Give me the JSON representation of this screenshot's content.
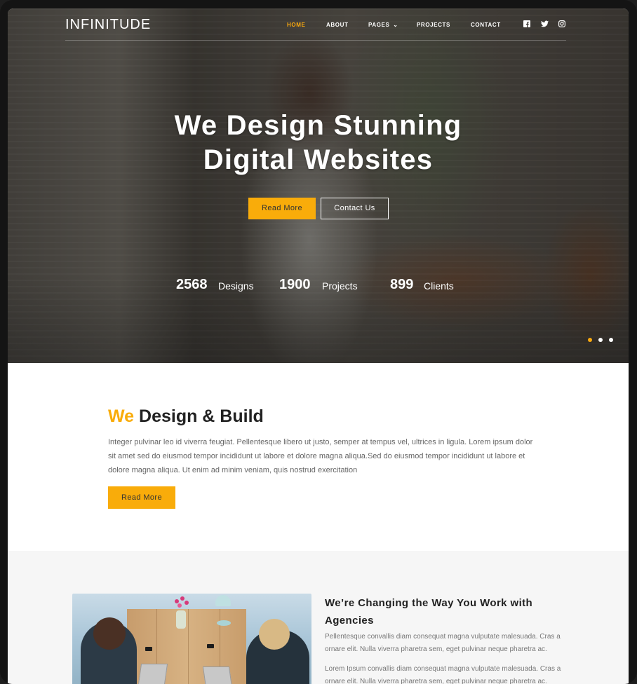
{
  "brand": {
    "name": "INFINITUDE",
    "accent_color": "#f9ac0a"
  },
  "nav": {
    "items": [
      {
        "label": "HOME",
        "active": true
      },
      {
        "label": "ABOUT",
        "active": false
      },
      {
        "label": "PAGES",
        "active": false,
        "has_dropdown": true
      },
      {
        "label": "PROJECTS",
        "active": false
      },
      {
        "label": "CONTACT",
        "active": false
      }
    ],
    "dropdown_caret": "⌄",
    "social_icons": [
      "facebook-icon",
      "twitter-icon",
      "instagram-icon"
    ]
  },
  "hero": {
    "title_line1": "We Design Stunning",
    "title_line2": "Digital Websites",
    "primary_button": "Read More",
    "secondary_button": "Contact Us",
    "stats": [
      {
        "value": "2568",
        "label": "Designs"
      },
      {
        "value": "1900",
        "label": "Projects"
      },
      {
        "value": "899",
        "label": "Clients"
      }
    ],
    "slider_dots": 3,
    "active_dot": 0
  },
  "about": {
    "title_accent": "We",
    "title_rest": "Design & Build",
    "paragraph": "Integer pulvinar leo id viverra feugiat. Pellentesque libero ut justo, semper at tempus vel, ultrices in ligula. Lorem ipsum dolor sit amet sed do eiusmod tempor incididunt ut labore et dolore magna aliqua.Sed do eiusmod tempor incididunt ut labore et dolore magna aliqua. Ut enim ad minim veniam, quis nostrud exercitation",
    "button": "Read More"
  },
  "agency": {
    "title": "We’re Changing the Way You Work with Agencies",
    "paragraph1": "Pellentesque convallis diam consequat magna vulputate malesuada. Cras a ornare elit. Nulla viverra pharetra sem, eget pulvinar neque pharetra ac.",
    "paragraph2": "Lorem Ipsum convallis diam consequat magna vulputate malesuada. Cras a ornare elit. Nulla viverra pharetra sem, eget pulvinar neque pharetra ac."
  }
}
